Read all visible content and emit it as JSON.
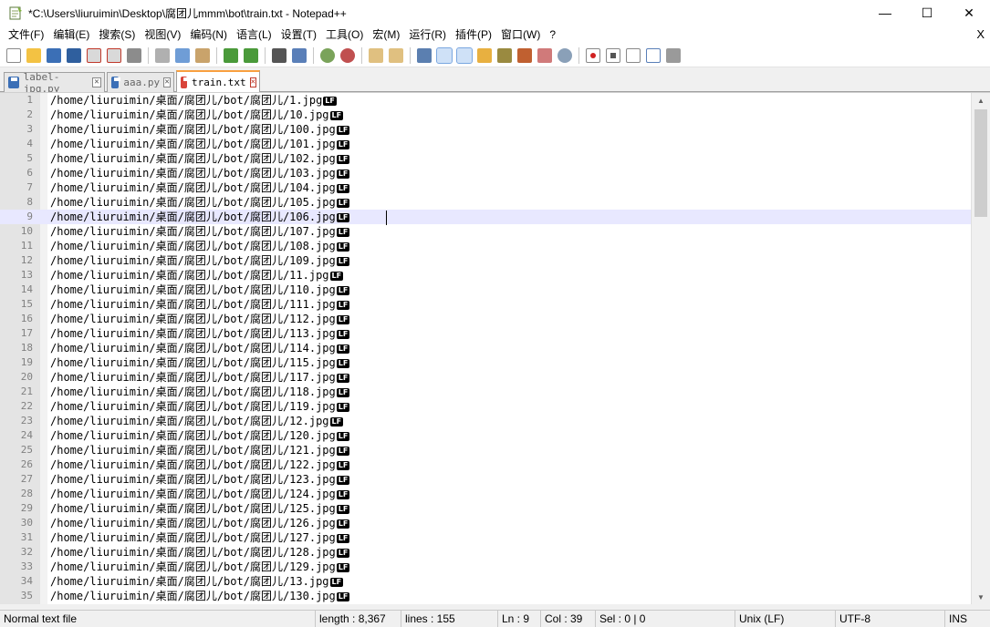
{
  "window": {
    "title": "*C:\\Users\\liuruimin\\Desktop\\腐团儿mmm\\bot\\train.txt - Notepad++",
    "minimize_glyph": "—",
    "maximize_glyph": "☐",
    "close_glyph": "✕"
  },
  "menu": {
    "items": [
      "文件(F)",
      "编辑(E)",
      "搜索(S)",
      "视图(V)",
      "编码(N)",
      "语言(L)",
      "设置(T)",
      "工具(O)",
      "宏(M)",
      "运行(R)",
      "插件(P)",
      "窗口(W)",
      "?"
    ],
    "close_doc": "X"
  },
  "toolbar": {
    "icons": [
      "new-icon",
      "open-icon",
      "save-icon",
      "save-all-icon",
      "close-icon",
      "close-all-icon",
      "print-icon",
      "cut-icon",
      "copy-icon",
      "paste-icon",
      "undo-icon",
      "redo-icon",
      "find-icon",
      "replace-icon",
      "zoom-in-icon",
      "zoom-out-icon",
      "sync-vertical-icon",
      "sync-horizontal-icon",
      "word-wrap-icon",
      "show-all-chars-icon",
      "indent-guide-icon",
      "udl-icon",
      "doc-map-icon",
      "function-list-icon",
      "folder-workspace-icon",
      "monitoring-icon",
      "record-macro-icon",
      "stop-macro-icon",
      "play-macro-icon",
      "run-macro-multiple-icon",
      "save-macro-icon"
    ]
  },
  "tabs": [
    {
      "label": "label-jpg.py",
      "active": false,
      "close": "✕"
    },
    {
      "label": "aaa.py",
      "active": false,
      "close": "✕"
    },
    {
      "label": "train.txt",
      "active": true,
      "close": "✕"
    }
  ],
  "editor": {
    "eol_marker": "LF",
    "current_line": 9,
    "lines": [
      {
        "n": "1",
        "text": "/home/liuruimin/桌面/腐团儿/bot/腐团儿/1.jpg"
      },
      {
        "n": "2",
        "text": "/home/liuruimin/桌面/腐团儿/bot/腐团儿/10.jpg"
      },
      {
        "n": "3",
        "text": "/home/liuruimin/桌面/腐团儿/bot/腐团儿/100.jpg"
      },
      {
        "n": "4",
        "text": "/home/liuruimin/桌面/腐团儿/bot/腐团儿/101.jpg"
      },
      {
        "n": "5",
        "text": "/home/liuruimin/桌面/腐团儿/bot/腐团儿/102.jpg"
      },
      {
        "n": "6",
        "text": "/home/liuruimin/桌面/腐团儿/bot/腐团儿/103.jpg"
      },
      {
        "n": "7",
        "text": "/home/liuruimin/桌面/腐团儿/bot/腐团儿/104.jpg"
      },
      {
        "n": "8",
        "text": "/home/liuruimin/桌面/腐团儿/bot/腐团儿/105.jpg"
      },
      {
        "n": "9",
        "text": "/home/liuruimin/桌面/腐团儿/bot/腐团儿/106.jpg"
      },
      {
        "n": "10",
        "text": "/home/liuruimin/桌面/腐团儿/bot/腐团儿/107.jpg"
      },
      {
        "n": "11",
        "text": "/home/liuruimin/桌面/腐团儿/bot/腐团儿/108.jpg"
      },
      {
        "n": "12",
        "text": "/home/liuruimin/桌面/腐团儿/bot/腐团儿/109.jpg"
      },
      {
        "n": "13",
        "text": "/home/liuruimin/桌面/腐团儿/bot/腐团儿/11.jpg"
      },
      {
        "n": "14",
        "text": "/home/liuruimin/桌面/腐团儿/bot/腐团儿/110.jpg"
      },
      {
        "n": "15",
        "text": "/home/liuruimin/桌面/腐团儿/bot/腐团儿/111.jpg"
      },
      {
        "n": "16",
        "text": "/home/liuruimin/桌面/腐团儿/bot/腐团儿/112.jpg"
      },
      {
        "n": "17",
        "text": "/home/liuruimin/桌面/腐团儿/bot/腐团儿/113.jpg"
      },
      {
        "n": "18",
        "text": "/home/liuruimin/桌面/腐团儿/bot/腐团儿/114.jpg"
      },
      {
        "n": "19",
        "text": "/home/liuruimin/桌面/腐团儿/bot/腐团儿/115.jpg"
      },
      {
        "n": "20",
        "text": "/home/liuruimin/桌面/腐团儿/bot/腐团儿/117.jpg"
      },
      {
        "n": "21",
        "text": "/home/liuruimin/桌面/腐团儿/bot/腐团儿/118.jpg"
      },
      {
        "n": "22",
        "text": "/home/liuruimin/桌面/腐团儿/bot/腐团儿/119.jpg"
      },
      {
        "n": "23",
        "text": "/home/liuruimin/桌面/腐团儿/bot/腐团儿/12.jpg"
      },
      {
        "n": "24",
        "text": "/home/liuruimin/桌面/腐团儿/bot/腐团儿/120.jpg"
      },
      {
        "n": "25",
        "text": "/home/liuruimin/桌面/腐团儿/bot/腐团儿/121.jpg"
      },
      {
        "n": "26",
        "text": "/home/liuruimin/桌面/腐团儿/bot/腐团儿/122.jpg"
      },
      {
        "n": "27",
        "text": "/home/liuruimin/桌面/腐团儿/bot/腐团儿/123.jpg"
      },
      {
        "n": "28",
        "text": "/home/liuruimin/桌面/腐团儿/bot/腐团儿/124.jpg"
      },
      {
        "n": "29",
        "text": "/home/liuruimin/桌面/腐团儿/bot/腐团儿/125.jpg"
      },
      {
        "n": "30",
        "text": "/home/liuruimin/桌面/腐团儿/bot/腐团儿/126.jpg"
      },
      {
        "n": "31",
        "text": "/home/liuruimin/桌面/腐团儿/bot/腐团儿/127.jpg"
      },
      {
        "n": "32",
        "text": "/home/liuruimin/桌面/腐团儿/bot/腐团儿/128.jpg"
      },
      {
        "n": "33",
        "text": "/home/liuruimin/桌面/腐团儿/bot/腐团儿/129.jpg"
      },
      {
        "n": "34",
        "text": "/home/liuruimin/桌面/腐团儿/bot/腐团儿/13.jpg"
      },
      {
        "n": "35",
        "text": "/home/liuruimin/桌面/腐团儿/bot/腐团儿/130.jpg"
      }
    ]
  },
  "status": {
    "file_type": "Normal text file",
    "length": "length : 8,367",
    "lines": "lines : 155",
    "ln": "Ln : 9",
    "col": "Col : 39",
    "sel": "Sel : 0 | 0",
    "eol": "Unix (LF)",
    "encoding": "UTF-8",
    "mode": "INS"
  },
  "colors": {
    "accent_tab": "#f9a03f",
    "current_line": "#e8e8ff",
    "gutter": "#e4e4e4"
  }
}
